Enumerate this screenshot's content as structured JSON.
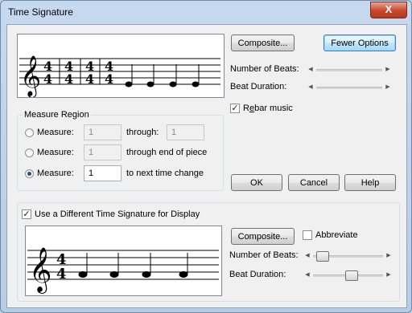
{
  "window": {
    "title": "Time Signature",
    "close_glyph": "X"
  },
  "top_preview": {
    "time_signatures": [
      "4|4",
      "4|4",
      "4|4",
      "4|4"
    ],
    "staff_icon": "treble-clef"
  },
  "buttons": {
    "composite_top": "Composite...",
    "fewer_options": "Fewer Options",
    "ok": "OK",
    "cancel": "Cancel",
    "help": "Help",
    "composite_bottom": "Composite..."
  },
  "top_sliders": {
    "beats_label": "Number of Beats:",
    "duration_label": "Beat Duration:"
  },
  "rebar": {
    "label_pre": "R",
    "label_ul": "e",
    "label_post": "bar music",
    "checked": true
  },
  "measure_region": {
    "legend": "Measure Region",
    "rows": [
      {
        "label": "Measure:",
        "value": "1",
        "connector": "through:",
        "end_value": "1",
        "selected": false
      },
      {
        "label": "Measure:",
        "value": "1",
        "connector": "through end of piece",
        "selected": false
      },
      {
        "label": "Measure:",
        "value": "1",
        "connector": "to next time change",
        "selected": true
      }
    ]
  },
  "display": {
    "use_different_label": "Use a Different Time Signature for Display",
    "use_different_checked": true,
    "abbreviate_label": "Abbreviate",
    "abbreviate_checked": false,
    "beats_label": "Number of Beats:",
    "duration_label": "Beat Duration:",
    "time_signature": "4|4",
    "beats_slider_level": 0.1,
    "duration_slider_level": 0.6
  }
}
